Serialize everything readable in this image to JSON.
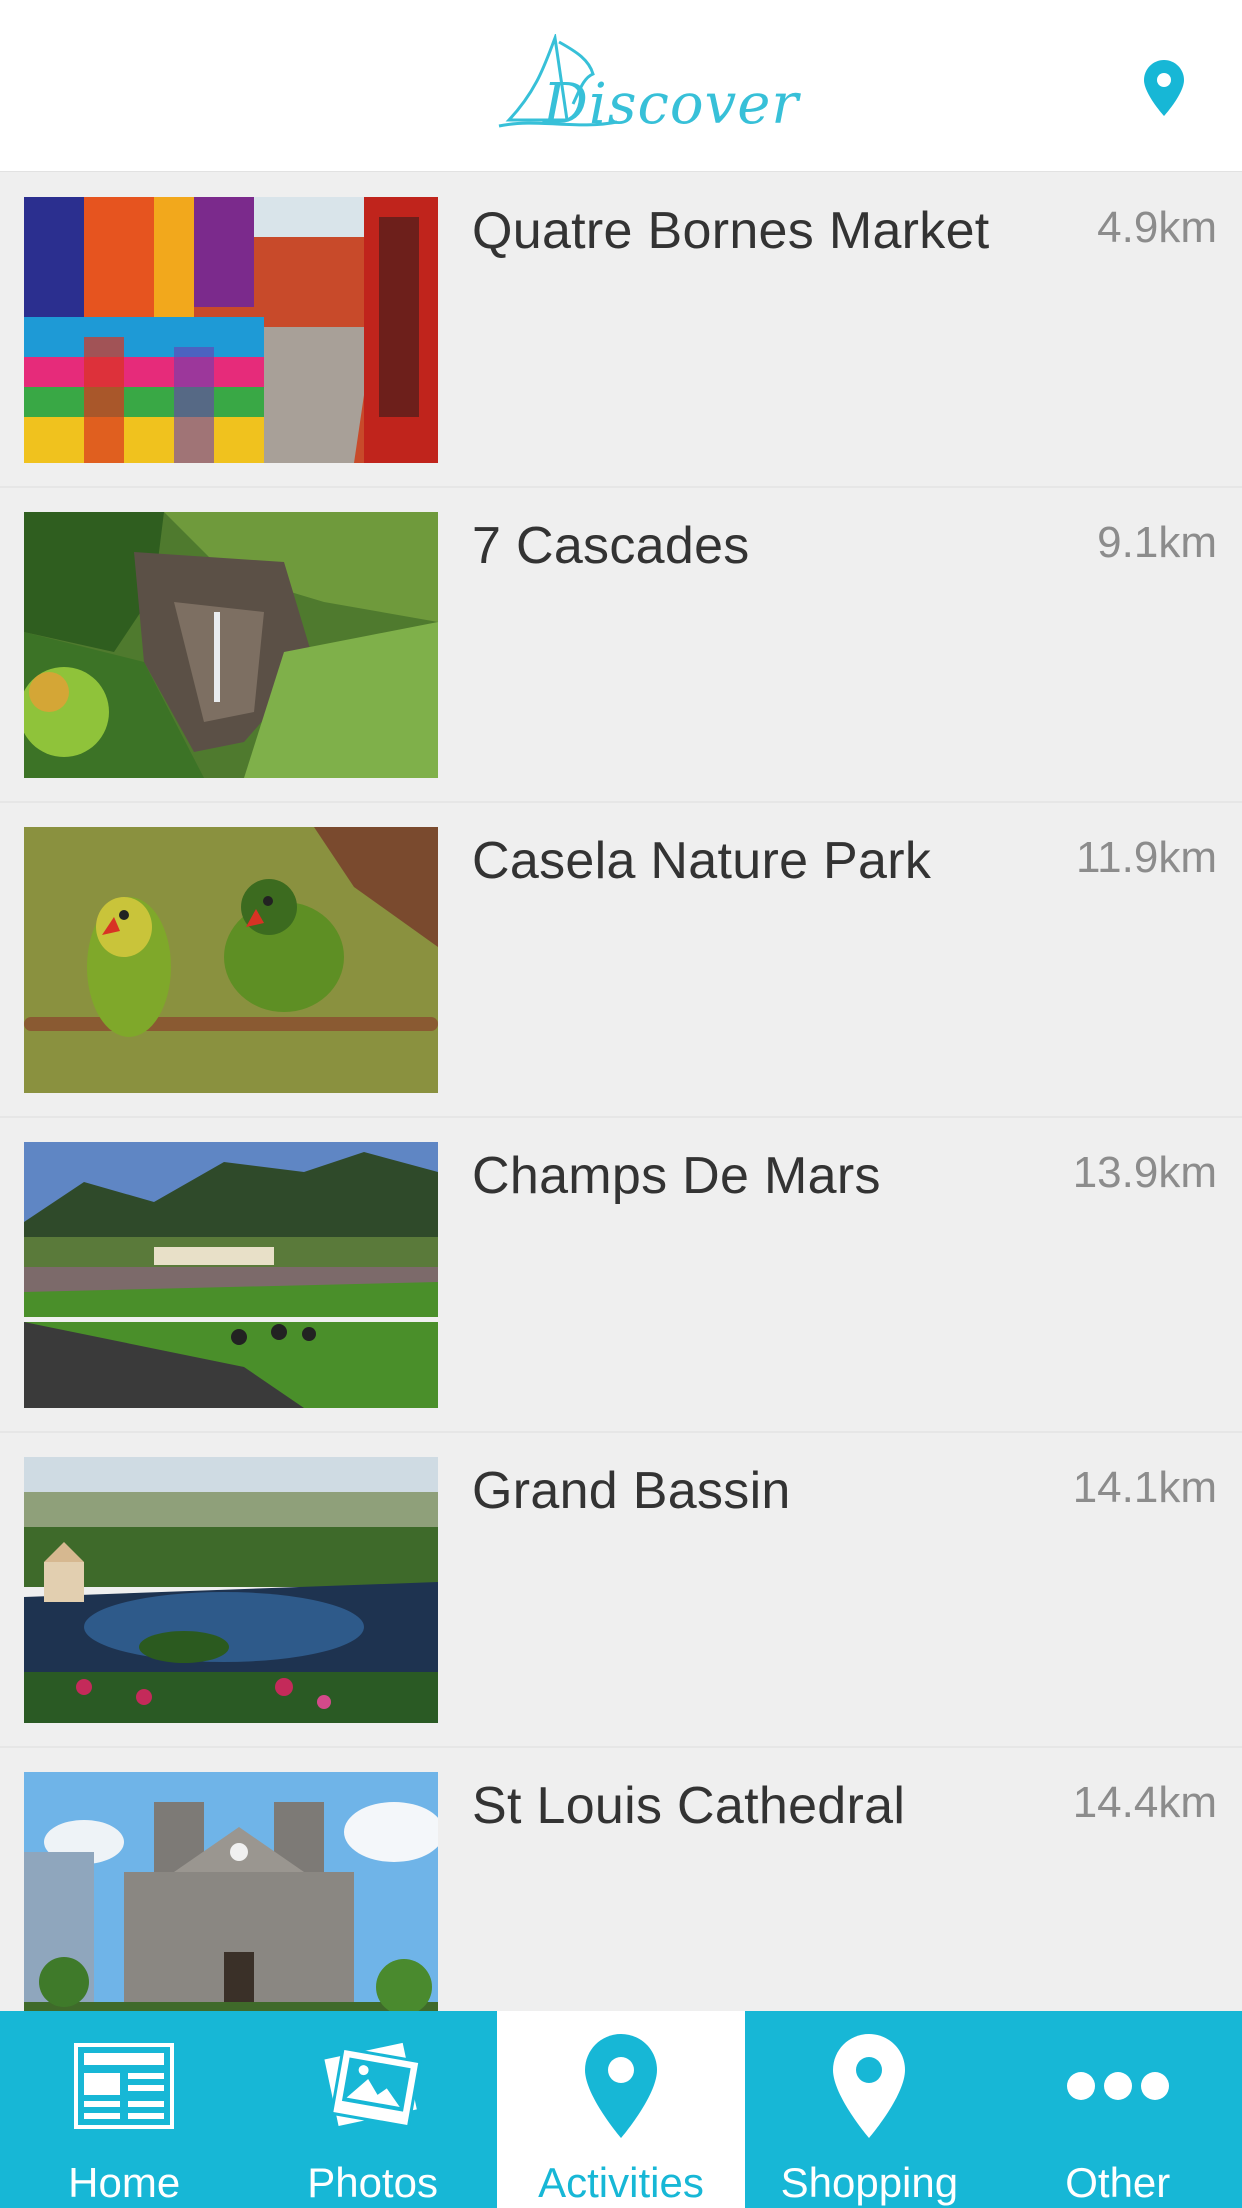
{
  "header": {
    "logo_text": "Discover",
    "location_icon": "location-pin-icon"
  },
  "colors": {
    "accent": "#17b7d6",
    "logo": "#37c0d8",
    "background": "#efefef",
    "title": "#333333",
    "distance": "#8c8c8c"
  },
  "places": [
    {
      "name": "Quatre Bornes Market",
      "distance": "4.9km"
    },
    {
      "name": "7 Cascades",
      "distance": "9.1km"
    },
    {
      "name": "Casela Nature Park",
      "distance": "11.9km"
    },
    {
      "name": "Champs De Mars",
      "distance": "13.9km"
    },
    {
      "name": "Grand Bassin",
      "distance": "14.1km"
    },
    {
      "name": "St Louis Cathedral",
      "distance": "14.4km"
    }
  ],
  "tabs": [
    {
      "label": "Home",
      "icon": "newspaper-icon",
      "active": false
    },
    {
      "label": "Photos",
      "icon": "photos-icon",
      "active": false
    },
    {
      "label": "Activities",
      "icon": "location-pin-icon",
      "active": true
    },
    {
      "label": "Shopping",
      "icon": "location-pin-icon",
      "active": false
    },
    {
      "label": "Other",
      "icon": "more-dots-icon",
      "active": false
    }
  ]
}
